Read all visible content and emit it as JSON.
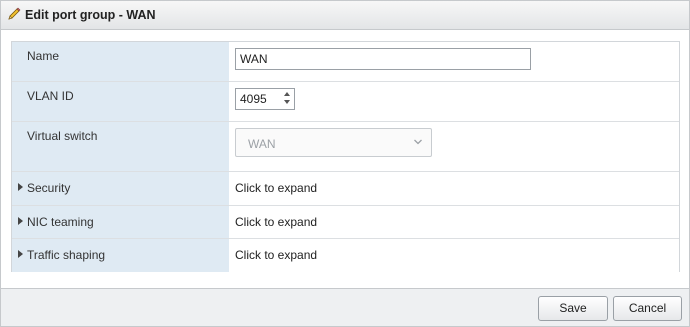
{
  "dialog": {
    "title": "Edit port group - WAN",
    "title_icon": "pencil-icon"
  },
  "form": {
    "name": {
      "label": "Name",
      "value": "WAN"
    },
    "vlan": {
      "label": "VLAN ID",
      "value": "4095"
    },
    "vswitch": {
      "label": "Virtual switch",
      "selected": "WAN",
      "disabled": true
    },
    "sections": [
      {
        "label": "Security",
        "value": "Click to expand"
      },
      {
        "label": "NIC teaming",
        "value": "Click to expand"
      },
      {
        "label": "Traffic shaping",
        "value": "Click to expand"
      }
    ]
  },
  "footer": {
    "save_label": "Save",
    "cancel_label": "Cancel"
  },
  "colors": {
    "label_cell_bg": "#dfeaf3",
    "dialog_bg": "#eef0f2"
  }
}
